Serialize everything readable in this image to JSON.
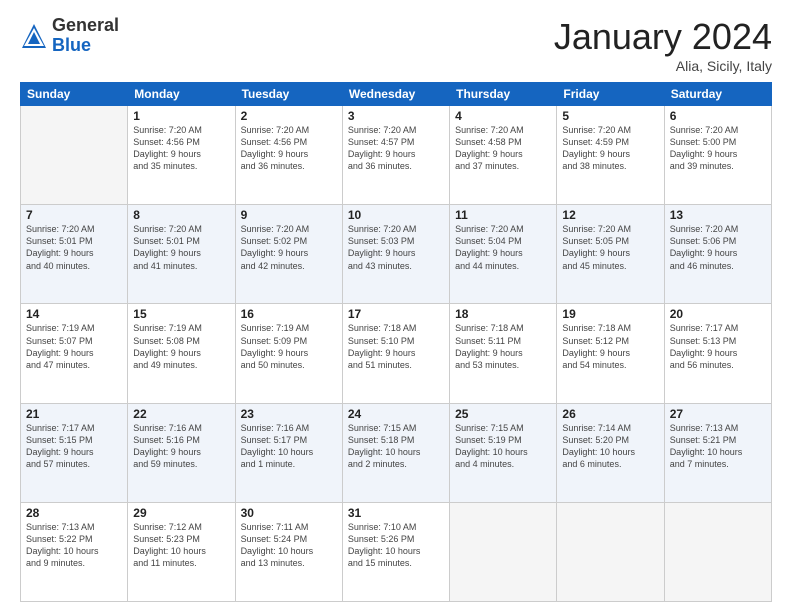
{
  "header": {
    "logo_general": "General",
    "logo_blue": "Blue",
    "month_title": "January 2024",
    "location": "Alia, Sicily, Italy"
  },
  "weekdays": [
    "Sunday",
    "Monday",
    "Tuesday",
    "Wednesday",
    "Thursday",
    "Friday",
    "Saturday"
  ],
  "weeks": [
    [
      {
        "day": "",
        "info": ""
      },
      {
        "day": "1",
        "info": "Sunrise: 7:20 AM\nSunset: 4:56 PM\nDaylight: 9 hours\nand 35 minutes."
      },
      {
        "day": "2",
        "info": "Sunrise: 7:20 AM\nSunset: 4:56 PM\nDaylight: 9 hours\nand 36 minutes."
      },
      {
        "day": "3",
        "info": "Sunrise: 7:20 AM\nSunset: 4:57 PM\nDaylight: 9 hours\nand 36 minutes."
      },
      {
        "day": "4",
        "info": "Sunrise: 7:20 AM\nSunset: 4:58 PM\nDaylight: 9 hours\nand 37 minutes."
      },
      {
        "day": "5",
        "info": "Sunrise: 7:20 AM\nSunset: 4:59 PM\nDaylight: 9 hours\nand 38 minutes."
      },
      {
        "day": "6",
        "info": "Sunrise: 7:20 AM\nSunset: 5:00 PM\nDaylight: 9 hours\nand 39 minutes."
      }
    ],
    [
      {
        "day": "7",
        "info": "Sunrise: 7:20 AM\nSunset: 5:01 PM\nDaylight: 9 hours\nand 40 minutes."
      },
      {
        "day": "8",
        "info": "Sunrise: 7:20 AM\nSunset: 5:01 PM\nDaylight: 9 hours\nand 41 minutes."
      },
      {
        "day": "9",
        "info": "Sunrise: 7:20 AM\nSunset: 5:02 PM\nDaylight: 9 hours\nand 42 minutes."
      },
      {
        "day": "10",
        "info": "Sunrise: 7:20 AM\nSunset: 5:03 PM\nDaylight: 9 hours\nand 43 minutes."
      },
      {
        "day": "11",
        "info": "Sunrise: 7:20 AM\nSunset: 5:04 PM\nDaylight: 9 hours\nand 44 minutes."
      },
      {
        "day": "12",
        "info": "Sunrise: 7:20 AM\nSunset: 5:05 PM\nDaylight: 9 hours\nand 45 minutes."
      },
      {
        "day": "13",
        "info": "Sunrise: 7:20 AM\nSunset: 5:06 PM\nDaylight: 9 hours\nand 46 minutes."
      }
    ],
    [
      {
        "day": "14",
        "info": "Sunrise: 7:19 AM\nSunset: 5:07 PM\nDaylight: 9 hours\nand 47 minutes."
      },
      {
        "day": "15",
        "info": "Sunrise: 7:19 AM\nSunset: 5:08 PM\nDaylight: 9 hours\nand 49 minutes."
      },
      {
        "day": "16",
        "info": "Sunrise: 7:19 AM\nSunset: 5:09 PM\nDaylight: 9 hours\nand 50 minutes."
      },
      {
        "day": "17",
        "info": "Sunrise: 7:18 AM\nSunset: 5:10 PM\nDaylight: 9 hours\nand 51 minutes."
      },
      {
        "day": "18",
        "info": "Sunrise: 7:18 AM\nSunset: 5:11 PM\nDaylight: 9 hours\nand 53 minutes."
      },
      {
        "day": "19",
        "info": "Sunrise: 7:18 AM\nSunset: 5:12 PM\nDaylight: 9 hours\nand 54 minutes."
      },
      {
        "day": "20",
        "info": "Sunrise: 7:17 AM\nSunset: 5:13 PM\nDaylight: 9 hours\nand 56 minutes."
      }
    ],
    [
      {
        "day": "21",
        "info": "Sunrise: 7:17 AM\nSunset: 5:15 PM\nDaylight: 9 hours\nand 57 minutes."
      },
      {
        "day": "22",
        "info": "Sunrise: 7:16 AM\nSunset: 5:16 PM\nDaylight: 9 hours\nand 59 minutes."
      },
      {
        "day": "23",
        "info": "Sunrise: 7:16 AM\nSunset: 5:17 PM\nDaylight: 10 hours\nand 1 minute."
      },
      {
        "day": "24",
        "info": "Sunrise: 7:15 AM\nSunset: 5:18 PM\nDaylight: 10 hours\nand 2 minutes."
      },
      {
        "day": "25",
        "info": "Sunrise: 7:15 AM\nSunset: 5:19 PM\nDaylight: 10 hours\nand 4 minutes."
      },
      {
        "day": "26",
        "info": "Sunrise: 7:14 AM\nSunset: 5:20 PM\nDaylight: 10 hours\nand 6 minutes."
      },
      {
        "day": "27",
        "info": "Sunrise: 7:13 AM\nSunset: 5:21 PM\nDaylight: 10 hours\nand 7 minutes."
      }
    ],
    [
      {
        "day": "28",
        "info": "Sunrise: 7:13 AM\nSunset: 5:22 PM\nDaylight: 10 hours\nand 9 minutes."
      },
      {
        "day": "29",
        "info": "Sunrise: 7:12 AM\nSunset: 5:23 PM\nDaylight: 10 hours\nand 11 minutes."
      },
      {
        "day": "30",
        "info": "Sunrise: 7:11 AM\nSunset: 5:24 PM\nDaylight: 10 hours\nand 13 minutes."
      },
      {
        "day": "31",
        "info": "Sunrise: 7:10 AM\nSunset: 5:26 PM\nDaylight: 10 hours\nand 15 minutes."
      },
      {
        "day": "",
        "info": ""
      },
      {
        "day": "",
        "info": ""
      },
      {
        "day": "",
        "info": ""
      }
    ]
  ]
}
